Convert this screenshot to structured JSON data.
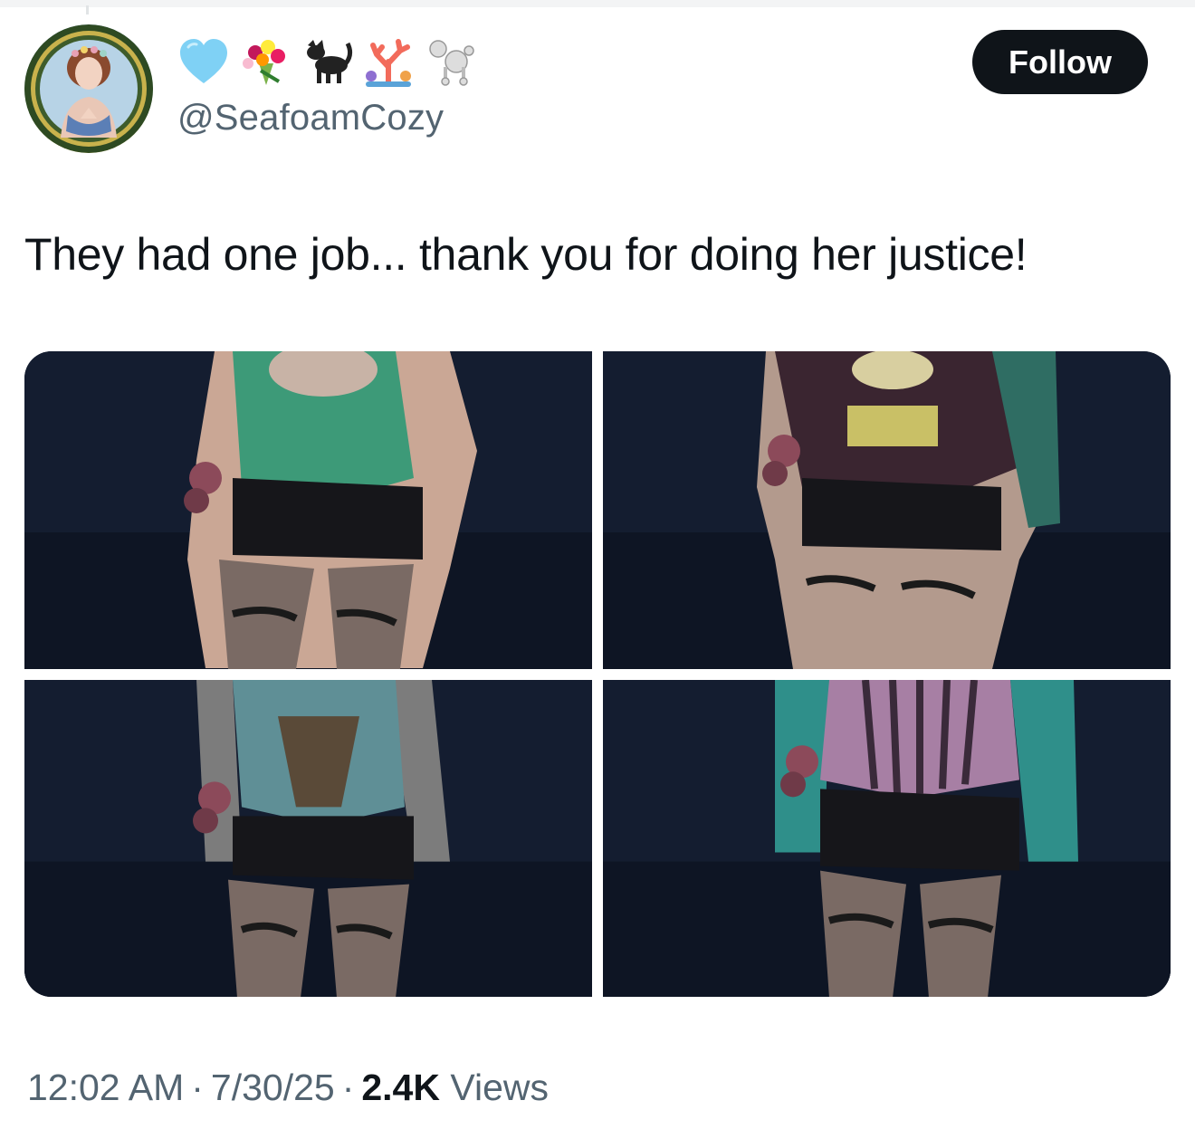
{
  "profile": {
    "handle": "@SeafoamCozy",
    "name_emojis": [
      "light-blue-heart",
      "bouquet",
      "black-cat",
      "coral",
      "poodle"
    ],
    "follow_label": "Follow"
  },
  "tweet": {
    "text": "They had one job... thank you for doing her justice!"
  },
  "media": [
    {
      "label": "outfit-1-green-tank"
    },
    {
      "label": "outfit-2-dark-sweater"
    },
    {
      "label": "outfit-3-striped-sleeves-corset"
    },
    {
      "label": "outfit-4-teal-sleeves-pink-corset"
    }
  ],
  "meta": {
    "time": "12:02 AM",
    "date": "7/30/25",
    "views_count": "2.4K",
    "views_label": "Views",
    "separator": "·"
  },
  "colors": {
    "text_primary": "#0f1419",
    "text_secondary": "#536471",
    "follow_bg": "#0f1419",
    "follow_text": "#ffffff"
  }
}
